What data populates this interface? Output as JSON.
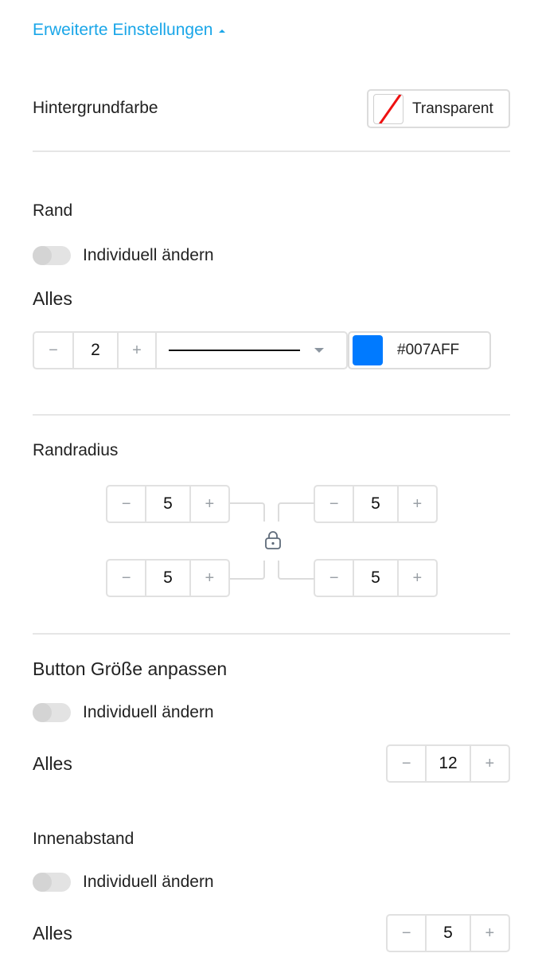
{
  "advanced_toggle": {
    "label": "Erweiterte Einstellungen"
  },
  "background": {
    "label": "Hintergrundfarbe",
    "value": "Transparent"
  },
  "border": {
    "title": "Rand",
    "switch_label": "Individuell ändern",
    "all_label": "Alles",
    "width_value": "2",
    "minus": "−",
    "plus": "+",
    "color_value": "#007AFF",
    "color_swatch": "#007AFF"
  },
  "radius": {
    "title": "Randradius",
    "top_left": "5",
    "top_right": "5",
    "bottom_left": "5",
    "bottom_right": "5",
    "minus": "−",
    "plus": "+",
    "lock_icon": "lock-icon"
  },
  "button_size": {
    "title": "Button Größe anpassen",
    "switch_label": "Individuell ändern",
    "all_label": "Alles",
    "value": "12",
    "minus": "−",
    "plus": "+"
  },
  "padding": {
    "title": "Innenabstand",
    "switch_label": "Individuell ändern",
    "all_label": "Alles",
    "value": "5",
    "minus": "−",
    "plus": "+"
  }
}
